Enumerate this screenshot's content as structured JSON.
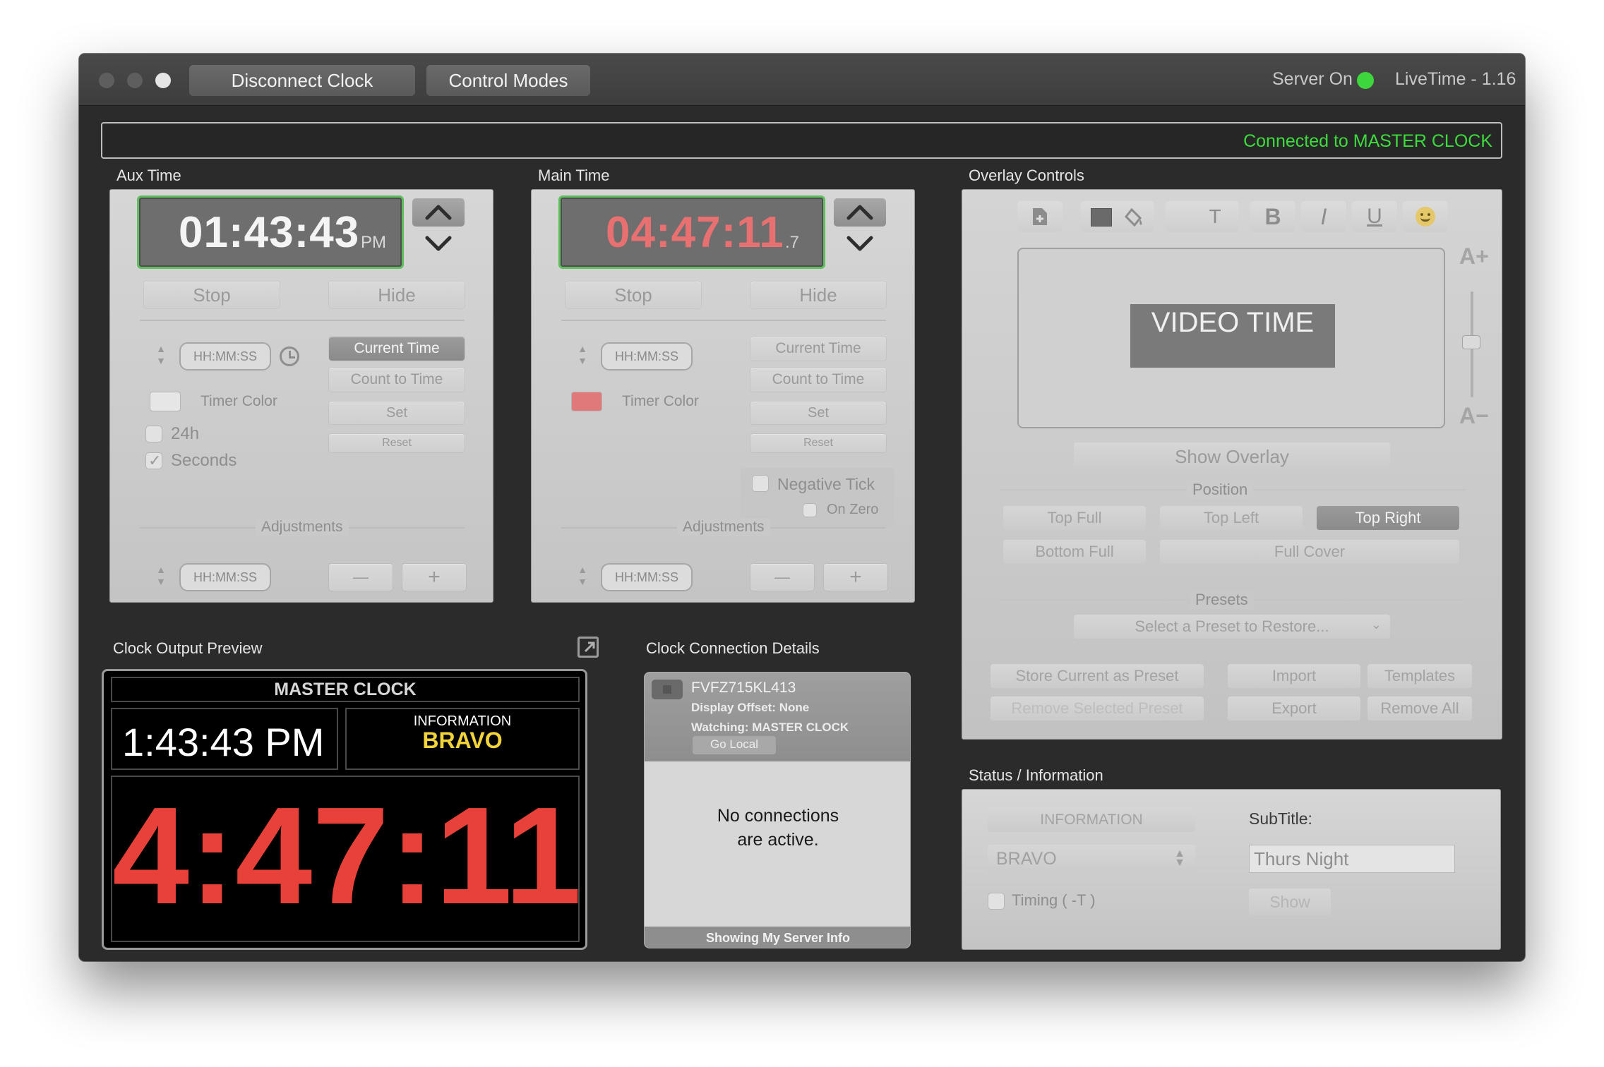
{
  "window": {
    "disconnect_label": "Disconnect Clock",
    "control_modes_label": "Control Modes",
    "server_status": "Server On",
    "app_version": "LiveTime - 1.16",
    "connection_status": "Connected to MASTER CLOCK",
    "colors": {
      "accent_green": "#3ddc3d",
      "main_red": "#e8413a"
    }
  },
  "aux": {
    "section": "Aux Time",
    "time": "01:43:43",
    "suffix": "PM",
    "stop": "Stop",
    "hide": "Hide",
    "placeholder": "HH:MM:SS",
    "current_time": "Current Time",
    "count_to_time": "Count to Time",
    "set": "Set",
    "reset": "Reset",
    "timer_color": "Timer Color",
    "h24": "24h",
    "seconds": "Seconds",
    "adjustments": "Adjustments",
    "minus": "—",
    "plus": "+"
  },
  "main": {
    "section": "Main Time",
    "time": "04:47:11",
    "suffix": ".7",
    "stop": "Stop",
    "hide": "Hide",
    "placeholder": "HH:MM:SS",
    "current_time": "Current Time",
    "count_to_time": "Count to Time",
    "set": "Set",
    "reset": "Reset",
    "timer_color": "Timer Color",
    "negative_tick": "Negative Tick",
    "on_zero": "On Zero",
    "adjustments": "Adjustments",
    "minus": "—",
    "plus": "+"
  },
  "overlay": {
    "section": "Overlay Controls",
    "bold": "B",
    "italic": "I",
    "underline": "U",
    "text_tool": "T",
    "preview_text": "VIDEO TIME",
    "font_up": "A+",
    "font_down": "A−",
    "show_overlay": "Show Overlay",
    "position_label": "Position",
    "positions": [
      "Top Full",
      "Top Left",
      "Top Right",
      "Bottom Full",
      "Full Cover"
    ],
    "presets_label": "Presets",
    "preset_select": "Select a Preset to Restore...",
    "store_preset": "Store Current as Preset",
    "remove_preset": "Remove Selected Preset",
    "import": "Import",
    "export": "Export",
    "templates": "Templates",
    "remove_all": "Remove All"
  },
  "preview": {
    "section": "Clock Output Preview",
    "header": "MASTER CLOCK",
    "aux_time": "1:43:43 PM",
    "info_label": "INFORMATION",
    "info_value": "BRAVO",
    "main_time": "4:47:11"
  },
  "connection": {
    "section": "Clock Connection Details",
    "id": "FVFZ715KL413",
    "offset": "Display Offset: None",
    "watching": "Watching: MASTER CLOCK",
    "go_local": "Go Local",
    "empty_line1": "No connections",
    "empty_line2": "are active.",
    "footer": "Showing My Server Info"
  },
  "status": {
    "section": "Status / Information",
    "info_button": "INFORMATION",
    "info_select": "BRAVO",
    "timing": "Timing ( -T )",
    "subtitle_label": "SubTitle:",
    "subtitle_value": "Thurs Night",
    "show": "Show"
  }
}
